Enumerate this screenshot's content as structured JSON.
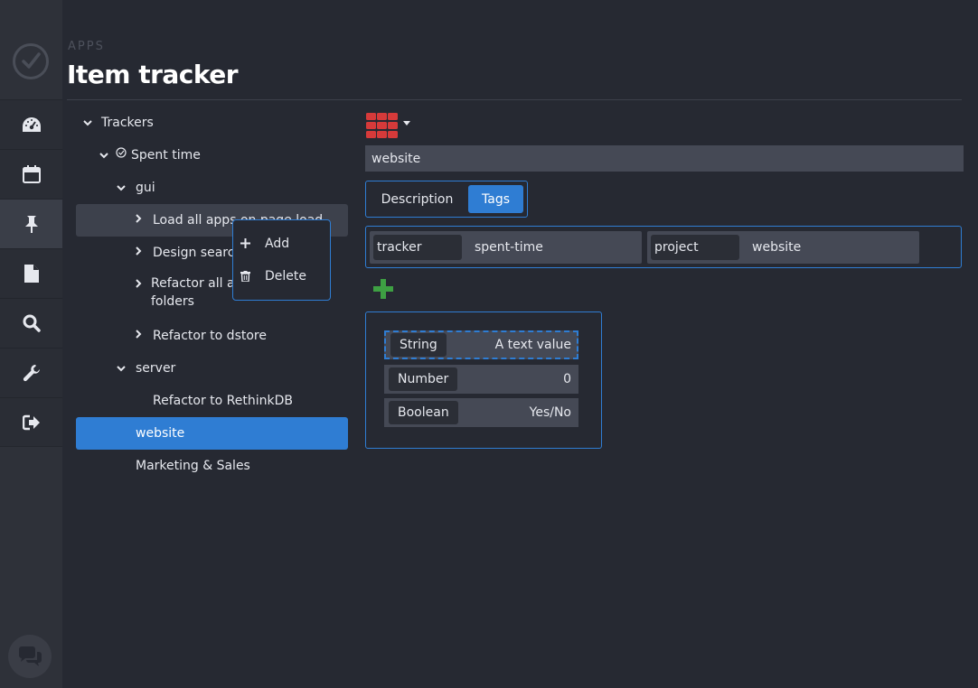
{
  "header": {
    "section": "APPS",
    "title": "Item tracker"
  },
  "sidebar": {
    "items": [
      {
        "name": "dashboard",
        "icon": "dashboard-icon"
      },
      {
        "name": "calendar",
        "icon": "calendar-icon"
      },
      {
        "name": "pinned",
        "icon": "pin-icon",
        "active": true
      },
      {
        "name": "documents",
        "icon": "document-icon"
      },
      {
        "name": "search",
        "icon": "search-icon"
      },
      {
        "name": "settings",
        "icon": "wrench-icon"
      },
      {
        "name": "logout",
        "icon": "logout-icon"
      }
    ],
    "chat_icon": "chat-icon"
  },
  "tree": {
    "items": [
      {
        "label": "Trackers",
        "expanded": true
      },
      {
        "label": "Spent time",
        "expanded": true
      },
      {
        "label": "gui",
        "expanded": true
      },
      {
        "label": "Load all apps on page load",
        "collapsed": true
      },
      {
        "label": "Design search",
        "collapsed": true
      },
      {
        "label": "Refactor all apps into folders",
        "line1": "Refactor all ap",
        "line2": "folders",
        "collapsed": true
      },
      {
        "label": "Refactor to dstore",
        "collapsed": true
      },
      {
        "label": "server",
        "expanded": true
      },
      {
        "label": "Refactor to RethinkDB"
      },
      {
        "label": "website",
        "selected": true
      },
      {
        "label": "Marketing & Sales"
      }
    ]
  },
  "context_menu": {
    "add_label": "Add",
    "delete_label": "Delete"
  },
  "detail": {
    "color": "#d63a3a",
    "name_value": "website",
    "tabs": [
      {
        "label": "Description"
      },
      {
        "label": "Tags",
        "active": true
      }
    ],
    "tags": [
      {
        "key": "tracker",
        "value": "spent-time"
      },
      {
        "key": "project",
        "value": "website"
      }
    ],
    "types": [
      {
        "type": "String",
        "value": "A text value"
      },
      {
        "type": "Number",
        "value": "0"
      },
      {
        "type": "Boolean",
        "value": "Yes/No"
      }
    ]
  },
  "colors": {
    "accent": "#2f7dd3",
    "add_green": "#3ea043",
    "grid_red": "#d63a3a"
  }
}
